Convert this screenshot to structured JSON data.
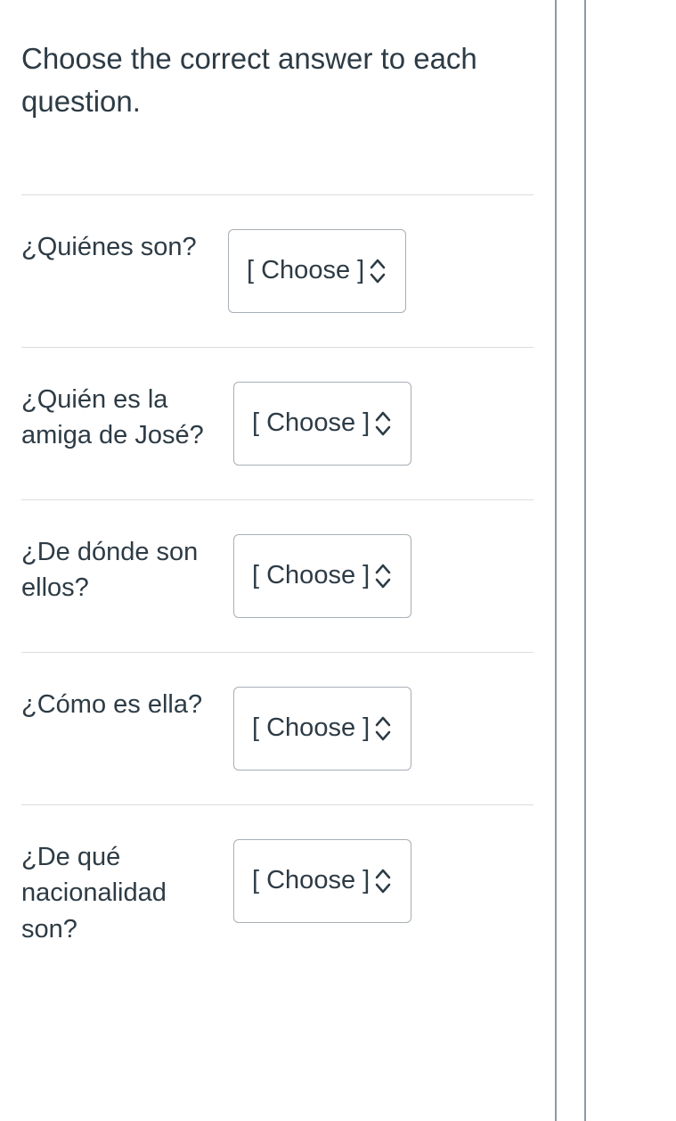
{
  "instructions": "Choose the correct answer to each question.",
  "select_placeholder": "[ Choose ]",
  "questions": [
    {
      "prompt": "¿Quiénes son?"
    },
    {
      "prompt": "¿Quién es la amiga de José?"
    },
    {
      "prompt": "¿De dónde son ellos?"
    },
    {
      "prompt": "¿Cómo es ella?"
    },
    {
      "prompt": "¿De qué nacionalidad son?"
    }
  ]
}
